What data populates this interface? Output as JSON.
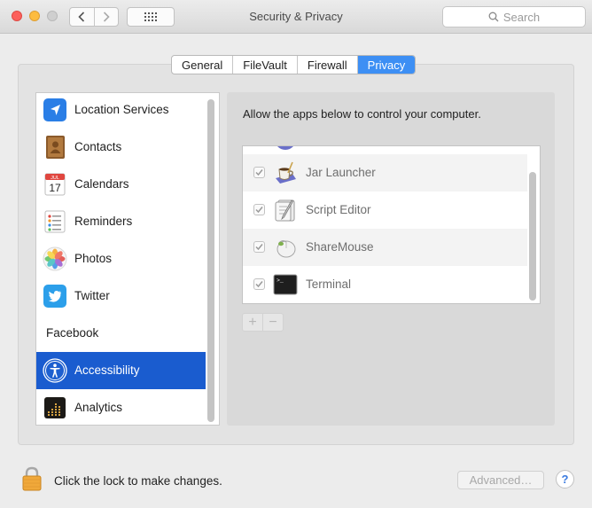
{
  "window": {
    "title": "Security & Privacy"
  },
  "toolbar": {
    "search_placeholder": "Search"
  },
  "tabs": [
    {
      "label": "General",
      "active": false
    },
    {
      "label": "FileVault",
      "active": false
    },
    {
      "label": "Firewall",
      "active": false
    },
    {
      "label": "Privacy",
      "active": true
    }
  ],
  "sidebar": {
    "items": [
      {
        "label": "Location Services",
        "icon": "location-arrow-icon"
      },
      {
        "label": "Contacts",
        "icon": "contacts-book-icon"
      },
      {
        "label": "Calendars",
        "icon": "calendar-icon",
        "icon_text_month": "JUL",
        "icon_text_day": "17"
      },
      {
        "label": "Reminders",
        "icon": "reminders-list-icon"
      },
      {
        "label": "Photos",
        "icon": "photos-flower-icon"
      },
      {
        "label": "Twitter",
        "icon": "twitter-bird-icon"
      },
      {
        "label": "Facebook",
        "icon": ""
      },
      {
        "label": "Accessibility",
        "icon": "accessibility-person-icon",
        "selected": true
      },
      {
        "label": "Analytics",
        "icon": "analytics-chart-icon"
      }
    ]
  },
  "privacy": {
    "description": "Allow the apps below to control your computer.",
    "apps": [
      {
        "label": "Jar Launcher",
        "checked": true,
        "icon": "coffee-cup-icon"
      },
      {
        "label": "Script Editor",
        "checked": true,
        "icon": "script-scroll-icon"
      },
      {
        "label": "ShareMouse",
        "checked": true,
        "icon": "mouse-icon"
      },
      {
        "label": "Terminal",
        "checked": true,
        "icon": "terminal-icon",
        "icon_text": ">_"
      }
    ],
    "add_label": "+",
    "remove_label": "−"
  },
  "footer": {
    "lock_text": "Click the lock to make changes.",
    "advanced_label": "Advanced…",
    "help_label": "?"
  },
  "colors": {
    "accent": "#3d8ff4",
    "selection": "#1a5ccf",
    "close": "#fc605c",
    "minimize": "#fdbc40"
  }
}
